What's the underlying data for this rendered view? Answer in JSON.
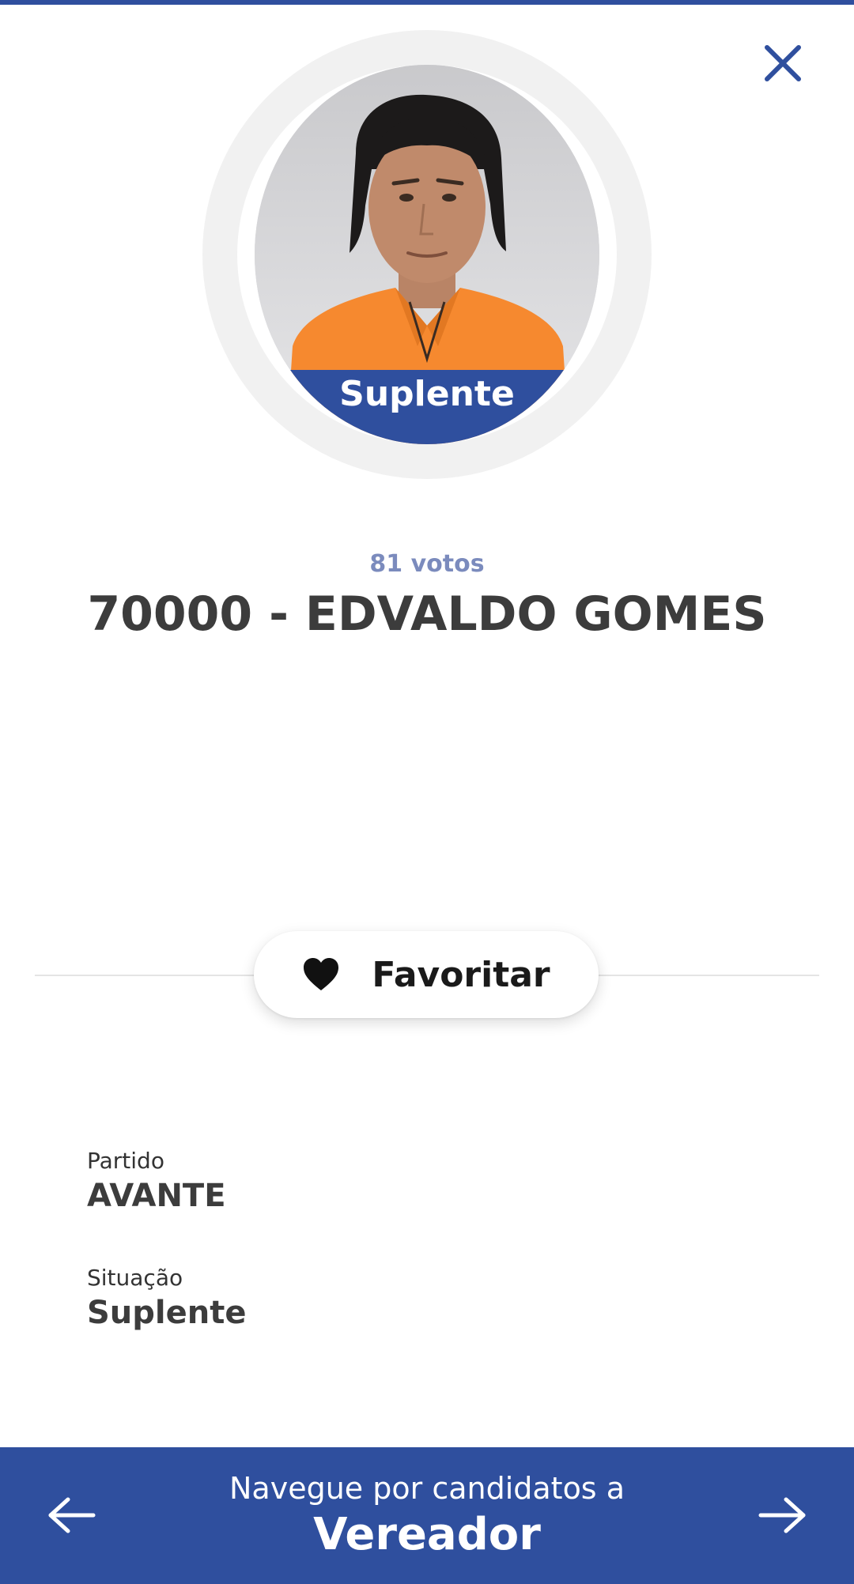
{
  "header": {
    "close_icon": "close-icon",
    "accent_color": "#2f4f9e"
  },
  "candidate": {
    "photo_badge": "Suplente",
    "votes": "81 votos",
    "title": "70000 - EDVALDO GOMES"
  },
  "favorite": {
    "label": "Favoritar",
    "icon": "heart-icon"
  },
  "details": {
    "party_label": "Partido",
    "party_value": "AVANTE",
    "status_label": "Situação",
    "status_value": "Suplente"
  },
  "footer": {
    "subtitle": "Navegue por candidatos a",
    "title": "Vereador",
    "prev_icon": "arrow-left-icon",
    "next_icon": "arrow-right-icon"
  }
}
